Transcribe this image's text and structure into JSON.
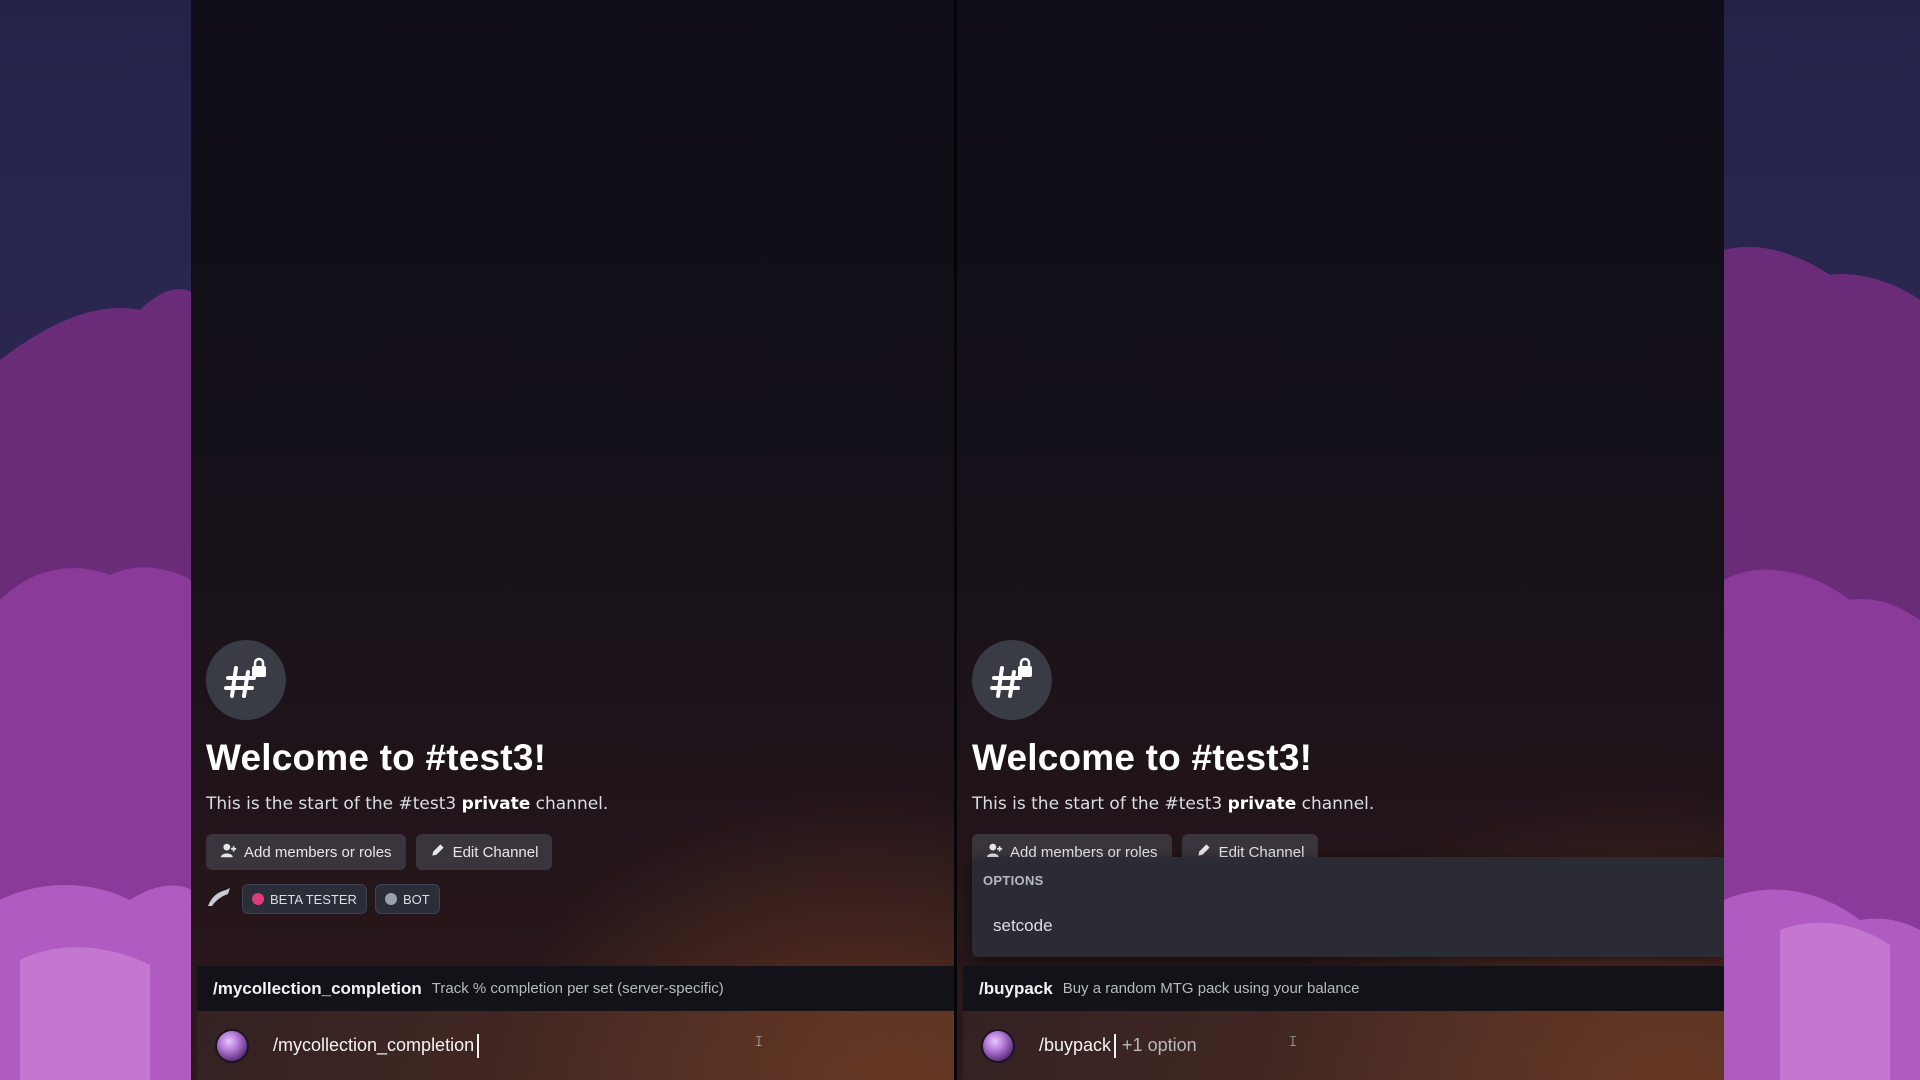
{
  "left_pane": {
    "welcome_title": "Welcome to #test3!",
    "desc_prefix": "This is the start of the #test3 ",
    "desc_bold": "private",
    "desc_suffix": " channel.",
    "add_members_label": "Add members or roles",
    "edit_channel_label": "Edit Channel",
    "badges": [
      {
        "label": "BETA TESTER",
        "color": "#e03b7a"
      },
      {
        "label": "BOT",
        "color": "#9aa0ab"
      }
    ],
    "suggestion": {
      "command": "/mycollection_completion",
      "description": "Track % completion per set (server-specific)"
    },
    "input": {
      "value": "/mycollection_completion"
    }
  },
  "right_pane": {
    "welcome_title": "Welcome to #test3!",
    "desc_prefix": "This is the start of the #test3 ",
    "desc_bold": "private",
    "desc_suffix": " channel.",
    "add_members_label": "Add members or roles",
    "edit_channel_label": "Edit Channel",
    "options_popup": {
      "heading": "OPTIONS",
      "items": [
        "setcode"
      ]
    },
    "suggestion": {
      "command": "/buypack",
      "description": "Buy a random MTG pack using your balance"
    },
    "input": {
      "value": "/buypack",
      "option_hint": "+1 option"
    }
  },
  "icons": {
    "channel": "hashtag-lock-icon",
    "add_members": "add-person-icon",
    "edit": "pencil-icon",
    "text_cursor": "i-beam-cursor-icon"
  },
  "colors": {
    "pane_bg": "#151019",
    "input_glow": "#6e3e28",
    "suggest_bg": "#121218",
    "options_bg": "#2a2b33"
  }
}
